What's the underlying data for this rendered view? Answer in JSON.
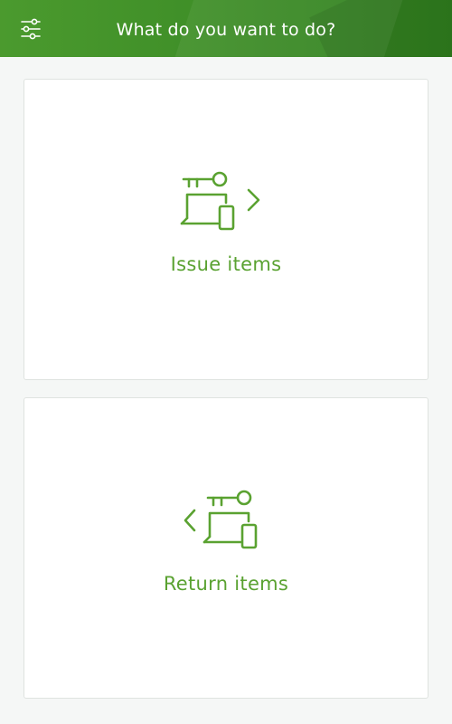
{
  "header": {
    "title": "What do you want to do?",
    "filter_icon": "sliders-filter-icon"
  },
  "actions": [
    {
      "label": "Issue items",
      "icon": "issue-items-icon",
      "direction": "right"
    },
    {
      "label": "Return items",
      "icon": "return-items-icon",
      "direction": "left"
    }
  ],
  "colors": {
    "header_green": "#3f8f28",
    "accent_green": "#5aa231",
    "background": "#f5f7f6",
    "card_background": "#ffffff"
  }
}
